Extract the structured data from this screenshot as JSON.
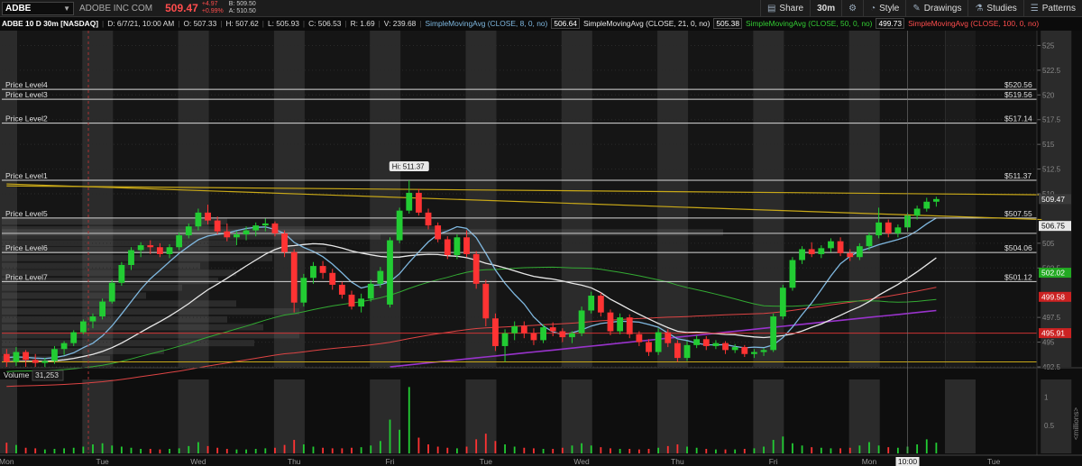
{
  "toolbar": {
    "symbol": "ADBE",
    "company": "ADOBE INC COM",
    "last": "509.47",
    "change": "+4.97",
    "change_pct": "+0.99%",
    "bid": "B: 509.50",
    "ask": "A: 510.50",
    "share_label": "Share",
    "timeframe_label": "30m",
    "style_label": "Style",
    "drawings_label": "Drawings",
    "studies_label": "Studies",
    "patterns_label": "Patterns"
  },
  "infobar": {
    "title": "ADBE 10 D 30m [NASDAQ]",
    "date": "D: 6/7/21, 10:00 AM",
    "open": "O: 507.33",
    "high": "H: 507.62",
    "low": "L: 505.93",
    "close": "C: 506.53",
    "range": "R: 1.69",
    "volume": "V: 239.68",
    "sma8_label": "SimpleMovingAvg (CLOSE, 8, 0, no)",
    "sma8_value": "506.64",
    "sma21_label": "SimpleMovingAvg (CLOSE, 21, 0, no)",
    "sma21_value": "505.38",
    "sma50_label": "SimpleMovingAvg (CLOSE, 50, 0, no)",
    "sma50_value": "499.73",
    "sma100_label": "SimpleMovingAvg (CLOSE, 100, 0, no)"
  },
  "colors": {
    "up": "#22cc33",
    "down": "#ff3333",
    "sma8": "#7fb8e0",
    "sma21": "#e8e8e8",
    "sma50": "#33aa33",
    "sma100": "#dd4444",
    "sma200": "#9933cc",
    "trend": "#c8a818"
  },
  "chart_data": {
    "type": "candlestick",
    "title": "ADBE 10 D 30m [NASDAQ]",
    "ylim": [
      492.5,
      526.5
    ],
    "yticks": [
      {
        "v": 525,
        "label": "525"
      },
      {
        "v": 522.5,
        "label": "522.5"
      },
      {
        "v": 520,
        "label": "520"
      },
      {
        "v": 517.5,
        "label": "517.5"
      },
      {
        "v": 515,
        "label": "515"
      },
      {
        "v": 512.5,
        "label": "512.5"
      },
      {
        "v": 510,
        "label": "510"
      },
      {
        "v": 505,
        "label": "505"
      },
      {
        "v": 502.5,
        "label": "502.5"
      },
      {
        "v": 497.5,
        "label": "497.5"
      },
      {
        "v": 495,
        "label": "495"
      },
      {
        "v": 492.5,
        "label": "492.5"
      }
    ],
    "x_labels": [
      {
        "label": "Mon",
        "x": 0.5
      },
      {
        "label": "Tue",
        "x": 10.5
      },
      {
        "label": "Wed",
        "x": 20.5
      },
      {
        "label": "Thu",
        "x": 30.5
      },
      {
        "label": "Fri",
        "x": 40.5
      },
      {
        "label": "Tue",
        "x": 50.5
      },
      {
        "label": "Wed",
        "x": 60.5
      },
      {
        "label": "Thu",
        "x": 70.5
      },
      {
        "label": "Fri",
        "x": 80.5
      },
      {
        "label": "Mon",
        "x": 90.5
      },
      {
        "label": "10:00",
        "x": 94.5
      },
      {
        "label": "Tue",
        "x": 103.5
      }
    ],
    "price_levels": [
      {
        "name": "Price Level4",
        "price": 520.56,
        "label": "$520.56"
      },
      {
        "name": "Price Level3",
        "price": 519.56,
        "label": "$519.56"
      },
      {
        "name": "Price Level2",
        "price": 517.14,
        "label": "$517.14"
      },
      {
        "name": "Price Level1",
        "price": 511.37,
        "label": "$511.37"
      },
      {
        "name": "Price Level5",
        "price": 507.55,
        "label": "$507.55"
      },
      {
        "name": "Price Level6",
        "price": 504.06,
        "label": "$504.06"
      },
      {
        "name": "Price Level7",
        "price": 501.12,
        "label": "$501.12"
      }
    ],
    "extra_lines": [
      {
        "price": 506.0,
        "color": "#cccccc"
      },
      {
        "price": 495.91,
        "color": "#cc3333"
      },
      {
        "price": 493.0,
        "color": "#c8a818"
      }
    ],
    "high_label": "Hi: 511.37",
    "high_index": 42,
    "right_labels": [
      {
        "label": "509.47",
        "price": 509.47,
        "bg": "#3a3a3a",
        "fg": "#ffffff"
      },
      {
        "label": "506.75",
        "price": 506.75,
        "bg": "#e8e8e8",
        "fg": "#000000"
      },
      {
        "label": "502.02",
        "price": 502.02,
        "bg": "#22aa22",
        "fg": "#ffffff"
      },
      {
        "label": "499.58",
        "price": 499.58,
        "bg": "#cc2222",
        "fg": "#ffffff"
      },
      {
        "label": "495.91",
        "price": 495.91,
        "bg": "#cc2222",
        "fg": "#ffffff"
      }
    ],
    "trendlines": [
      {
        "x1": 0,
        "y1": 511.0,
        "x2": 108,
        "y2": 507.4
      },
      {
        "x1": 0,
        "y1": 510.8,
        "x2": 108,
        "y2": 509.9
      }
    ],
    "ohlc": [
      [
        493.8,
        494.3,
        492.5,
        493.0
      ],
      [
        493.0,
        494.5,
        492.6,
        494.0
      ],
      [
        494.0,
        494.2,
        492.5,
        493.2
      ],
      [
        493.2,
        493.8,
        492.5,
        492.9
      ],
      [
        492.9,
        493.4,
        492.5,
        493.1
      ],
      [
        493.1,
        494.6,
        492.8,
        494.3
      ],
      [
        494.3,
        495.1,
        493.7,
        494.9
      ],
      [
        494.9,
        496.2,
        494.6,
        496.0
      ],
      [
        496.0,
        497.3,
        495.8,
        497.1
      ],
      [
        497.1,
        497.9,
        496.4,
        497.6
      ],
      [
        497.6,
        499.4,
        497.3,
        499.1
      ],
      [
        499.1,
        501.3,
        498.9,
        501.0
      ],
      [
        501.0,
        503.1,
        500.7,
        502.8
      ],
      [
        502.8,
        504.6,
        502.3,
        504.3
      ],
      [
        504.3,
        505.1,
        503.6,
        504.8
      ],
      [
        504.8,
        505.3,
        503.9,
        504.6
      ],
      [
        504.6,
        505.0,
        503.6,
        503.9
      ],
      [
        503.9,
        504.9,
        503.5,
        504.6
      ],
      [
        504.6,
        506.1,
        504.3,
        505.8
      ],
      [
        505.8,
        507.0,
        505.5,
        506.7
      ],
      [
        506.7,
        508.5,
        506.3,
        508.1
      ],
      [
        508.1,
        508.9,
        506.9,
        507.3
      ],
      [
        507.3,
        507.7,
        505.9,
        506.2
      ],
      [
        506.2,
        507.0,
        505.2,
        505.6
      ],
      [
        505.6,
        506.2,
        504.8,
        505.9
      ],
      [
        505.9,
        506.7,
        505.3,
        506.3
      ],
      [
        506.3,
        507.1,
        505.7,
        506.8
      ],
      [
        506.8,
        507.5,
        506.2,
        507.0
      ],
      [
        507.0,
        507.2,
        505.7,
        506.0
      ],
      [
        506.0,
        506.3,
        503.6,
        504.1
      ],
      [
        504.1,
        504.4,
        498.0,
        499.0
      ],
      [
        499.0,
        501.9,
        498.6,
        501.5
      ],
      [
        501.5,
        503.1,
        500.9,
        502.7
      ],
      [
        502.7,
        503.2,
        501.4,
        502.0
      ],
      [
        502.0,
        502.4,
        500.3,
        500.8
      ],
      [
        500.8,
        501.1,
        499.4,
        499.8
      ],
      [
        499.8,
        500.2,
        498.3,
        498.6
      ],
      [
        498.6,
        499.9,
        498.0,
        499.4
      ],
      [
        499.4,
        501.3,
        499.1,
        500.9
      ],
      [
        500.9,
        502.6,
        500.5,
        502.2
      ],
      [
        498.8,
        505.6,
        498.5,
        505.3
      ],
      [
        505.3,
        508.6,
        505.0,
        508.3
      ],
      [
        508.3,
        511.37,
        508.0,
        510.1
      ],
      [
        510.1,
        510.5,
        507.8,
        508.1
      ],
      [
        508.1,
        508.5,
        506.4,
        506.8
      ],
      [
        506.8,
        507.1,
        505.1,
        505.4
      ],
      [
        505.4,
        505.7,
        503.4,
        503.8
      ],
      [
        503.8,
        505.9,
        503.4,
        505.6
      ],
      [
        505.6,
        506.3,
        503.6,
        503.9
      ],
      [
        503.9,
        504.2,
        500.4,
        500.9
      ],
      [
        500.9,
        501.3,
        496.6,
        497.4
      ],
      [
        497.4,
        497.9,
        494.1,
        494.6
      ],
      [
        494.6,
        496.3,
        493.0,
        495.9
      ],
      [
        495.9,
        497.1,
        495.2,
        496.6
      ],
      [
        496.6,
        497.1,
        495.4,
        495.9
      ],
      [
        495.9,
        496.4,
        494.7,
        495.2
      ],
      [
        495.2,
        496.8,
        494.9,
        496.5
      ],
      [
        496.5,
        497.0,
        495.6,
        496.1
      ],
      [
        496.1,
        496.4,
        495.0,
        495.5
      ],
      [
        495.5,
        496.1,
        494.9,
        495.9
      ],
      [
        495.9,
        498.6,
        495.6,
        498.2
      ],
      [
        498.2,
        500.1,
        497.9,
        499.7
      ],
      [
        499.7,
        500.0,
        497.6,
        498.0
      ],
      [
        498.0,
        498.3,
        495.7,
        496.1
      ],
      [
        496.1,
        497.9,
        495.8,
        497.5
      ],
      [
        497.5,
        497.8,
        495.4,
        495.8
      ],
      [
        495.8,
        496.1,
        494.6,
        495.0
      ],
      [
        495.0,
        495.3,
        493.6,
        494.0
      ],
      [
        494.0,
        496.4,
        493.7,
        496.0
      ],
      [
        496.0,
        496.3,
        494.5,
        494.9
      ],
      [
        494.9,
        495.2,
        493.0,
        493.4
      ],
      [
        493.4,
        495.1,
        493.1,
        494.7
      ],
      [
        494.7,
        495.7,
        494.4,
        495.3
      ],
      [
        495.3,
        495.6,
        494.2,
        494.6
      ],
      [
        494.6,
        495.2,
        494.3,
        494.9
      ],
      [
        494.9,
        495.1,
        493.8,
        494.2
      ],
      [
        494.2,
        494.8,
        493.9,
        494.5
      ],
      [
        494.5,
        494.7,
        493.5,
        493.8
      ],
      [
        493.8,
        494.3,
        493.4,
        494.0
      ],
      [
        494.0,
        494.4,
        493.6,
        494.2
      ],
      [
        494.2,
        497.9,
        494.0,
        497.6
      ],
      [
        497.6,
        500.8,
        497.3,
        500.5
      ],
      [
        500.5,
        503.6,
        500.2,
        503.3
      ],
      [
        503.3,
        504.7,
        502.9,
        504.4
      ],
      [
        504.4,
        505.1,
        503.6,
        503.9
      ],
      [
        503.9,
        504.8,
        503.5,
        504.5
      ],
      [
        504.5,
        505.5,
        504.1,
        505.2
      ],
      [
        505.2,
        505.6,
        503.7,
        504.0
      ],
      [
        504.0,
        504.4,
        503.2,
        503.6
      ],
      [
        503.6,
        505.0,
        503.3,
        504.7
      ],
      [
        504.7,
        506.1,
        504.3,
        505.8
      ],
      [
        505.8,
        508.6,
        505.5,
        507.1
      ],
      [
        507.1,
        507.4,
        505.6,
        506.0
      ],
      [
        506.0,
        506.9,
        505.6,
        506.6
      ],
      [
        506.6,
        508.1,
        506.2,
        507.8
      ],
      [
        507.8,
        508.8,
        507.4,
        508.5
      ],
      [
        508.5,
        509.6,
        508.2,
        509.2
      ],
      [
        509.2,
        509.7,
        508.7,
        509.47
      ]
    ],
    "volume_label": "Volume",
    "volume_value": "31,253",
    "volume_unit": "<millions>",
    "volume_yticks": [
      {
        "v": 1,
        "label": "1"
      },
      {
        "v": 0.5,
        "label": "0.5"
      }
    ],
    "volume_ylim": [
      0,
      1.25
    ],
    "volume": [
      0.19,
      0.15,
      0.1,
      0.09,
      0.07,
      0.08,
      0.09,
      0.1,
      0.12,
      0.16,
      0.18,
      0.14,
      0.12,
      0.1,
      0.08,
      0.08,
      0.07,
      0.08,
      0.09,
      0.13,
      0.2,
      0.13,
      0.1,
      0.08,
      0.07,
      0.07,
      0.08,
      0.09,
      0.1,
      0.15,
      0.24,
      0.16,
      0.12,
      0.1,
      0.09,
      0.09,
      0.1,
      0.11,
      0.14,
      0.22,
      0.6,
      0.42,
      1.18,
      0.28,
      0.16,
      0.12,
      0.1,
      0.09,
      0.12,
      0.25,
      0.35,
      0.22,
      0.16,
      0.12,
      0.1,
      0.09,
      0.08,
      0.08,
      0.1,
      0.14,
      0.18,
      0.14,
      0.11,
      0.09,
      0.08,
      0.08,
      0.07,
      0.08,
      0.1,
      0.13,
      0.16,
      0.12,
      0.1,
      0.08,
      0.07,
      0.07,
      0.07,
      0.08,
      0.09,
      0.12,
      0.24,
      0.3,
      0.18,
      0.14,
      0.11,
      0.1,
      0.09,
      0.09,
      0.1,
      0.14,
      0.2,
      0.14,
      0.11,
      0.1,
      0.12,
      0.16,
      0.25,
      0.19
    ]
  }
}
